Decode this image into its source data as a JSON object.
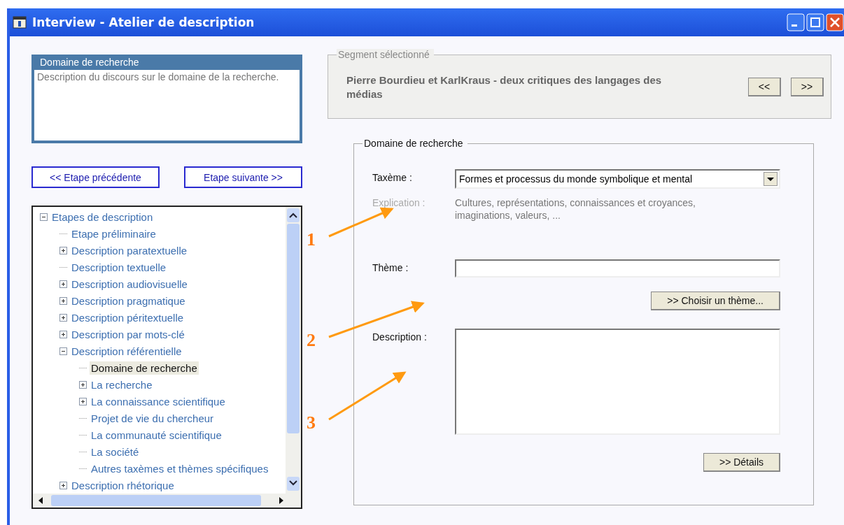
{
  "window": {
    "title": "Interview - Atelier de description"
  },
  "info_box": {
    "title": "Domaine de recherche",
    "text": "Description du discours sur le domaine de la recherche."
  },
  "nav_buttons": [
    "<< Etape précédente",
    "Etape suivante >>"
  ],
  "tree": [
    {
      "label": "Etapes de description",
      "expanded": true,
      "selected": false,
      "children": [
        {
          "label": "Etape préliminaire",
          "selected": false
        },
        {
          "label": "Description paratextuelle",
          "expanded": false,
          "selected": false
        },
        {
          "label": "Description textuelle",
          "selected": false
        },
        {
          "label": "Description audiovisuelle",
          "expanded": false,
          "selected": false
        },
        {
          "label": "Description pragmatique",
          "expanded": false,
          "selected": false
        },
        {
          "label": "Description péritextuelle",
          "expanded": false,
          "selected": false
        },
        {
          "label": "Description par mots-clé",
          "expanded": false,
          "selected": false
        },
        {
          "label": "Description référentielle",
          "expanded": true,
          "selected": false,
          "children": [
            {
              "label": "Domaine de recherche",
              "selected": true
            },
            {
              "label": "La recherche",
              "expanded": false,
              "selected": false
            },
            {
              "label": "La connaissance scientifique",
              "expanded": false,
              "selected": false
            },
            {
              "label": "Projet de vie du chercheur",
              "selected": false
            },
            {
              "label": "La communauté scientifique",
              "selected": false
            },
            {
              "label": "La société",
              "selected": false
            },
            {
              "label": "Autres taxèmes et thèmes spécifiques",
              "selected": false
            }
          ]
        },
        {
          "label": "Description rhétorique",
          "expanded": false,
          "selected": false
        }
      ]
    }
  ],
  "segment": {
    "title": "Segment sélectionné",
    "text": "Pierre Bourdieu et KarlKraus - deux critiques des langages des médias",
    "buttons": [
      "<<",
      ">>"
    ]
  },
  "form": {
    "title": "Domaine de recherche",
    "taxeme": {
      "label": "Taxème :",
      "value": "Formes et processus du monde symbolique et mental"
    },
    "explication": {
      "label": "Explication :",
      "text": "Cultures, représentations, connaissances et croyances, imaginations, valeurs, ..."
    },
    "theme": {
      "label": "Thème :",
      "button": ">> Choisir un thème..."
    },
    "description": {
      "label": "Description :",
      "button": ">> Détails"
    }
  },
  "annotations": [
    "1",
    "2",
    "3"
  ]
}
